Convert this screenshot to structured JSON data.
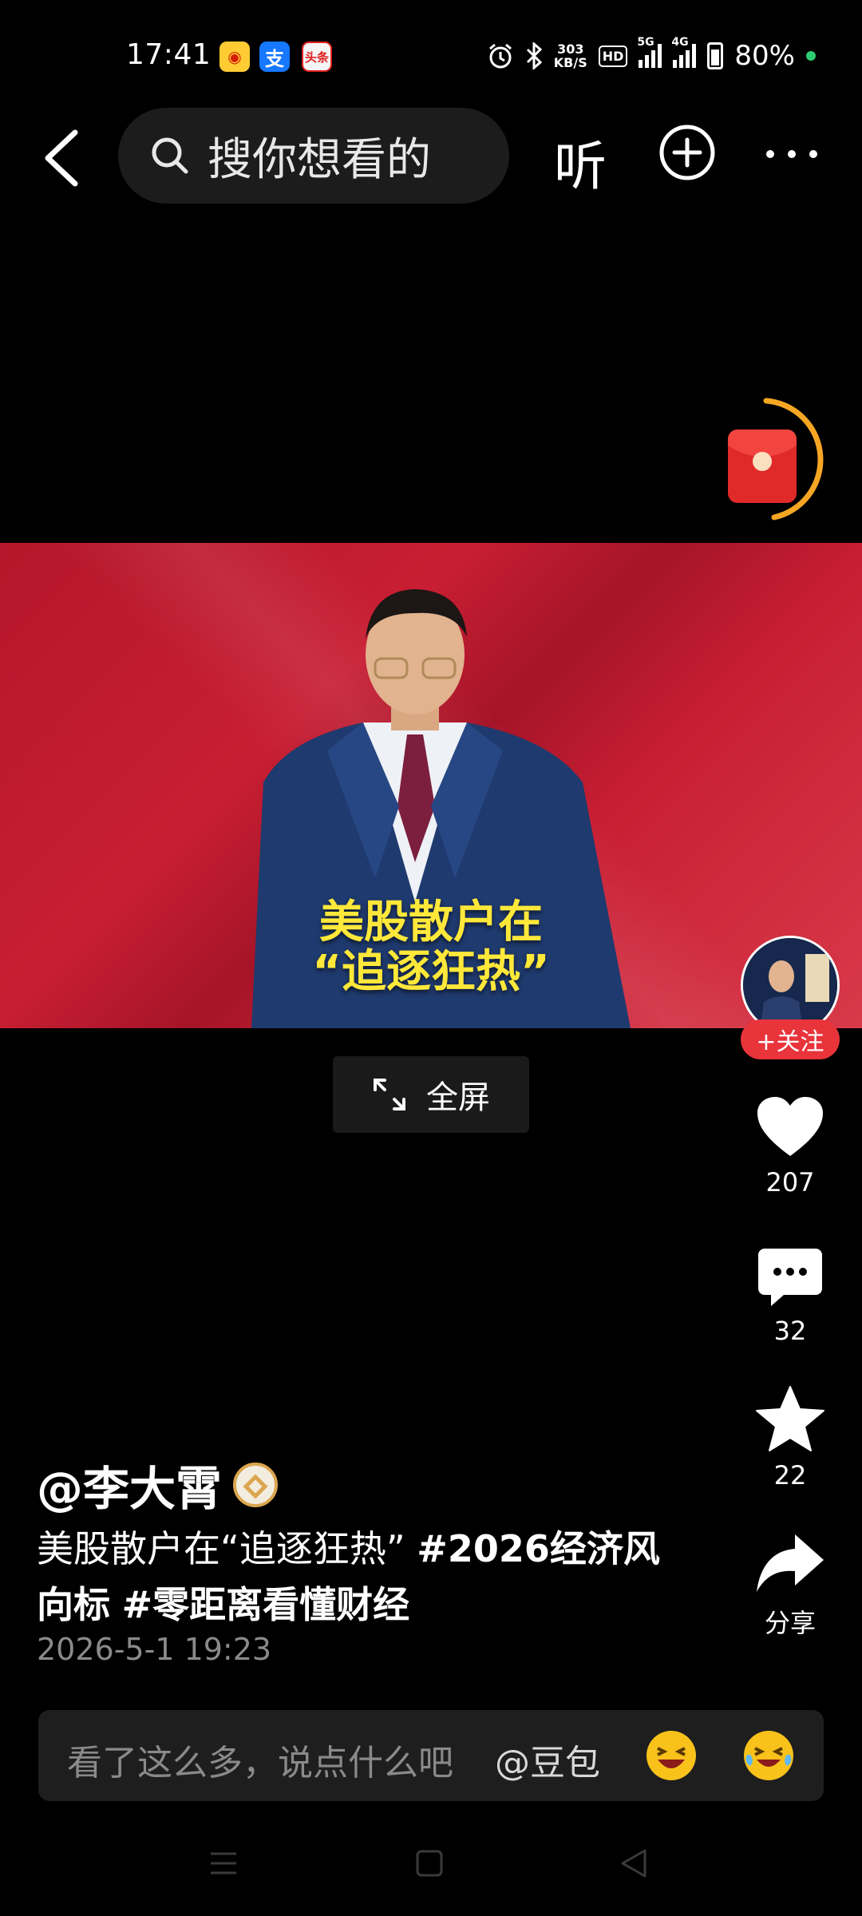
{
  "status_bar": {
    "time": "17:41",
    "app_icons": [
      "weibo-icon",
      "alipay-icon",
      "toutiao-icon"
    ],
    "net_speed_value": "303",
    "net_speed_unit": "KB/S",
    "hd_label": "HD",
    "sim1_label": "5G",
    "sim2_label": "4G",
    "battery": "80%"
  },
  "top_bar": {
    "search_placeholder": "搜你想看的",
    "listen_label": "听"
  },
  "video": {
    "caption_line1": "美股散户在",
    "caption_line2": "“追逐狂热”"
  },
  "fullscreen_label": "全屏",
  "rail": {
    "follow_label": "+关注",
    "likes": "207",
    "comments": "32",
    "favorites": "22",
    "share_label": "分享"
  },
  "post": {
    "author": "@李大霄",
    "desc_text": "美股散户在“追逐狂热” ",
    "tag1": "#2026经济风向标",
    "tag2": "#零距离看懂财经",
    "date": "2026-5-1 19:23"
  },
  "comment_bar": {
    "placeholder": "看了这么多，说点什么吧",
    "mention": "@豆包"
  },
  "colors": {
    "accent_red": "#e9343b",
    "caption_yellow": "#ffe83a",
    "progress_orange": "#f5a623"
  }
}
